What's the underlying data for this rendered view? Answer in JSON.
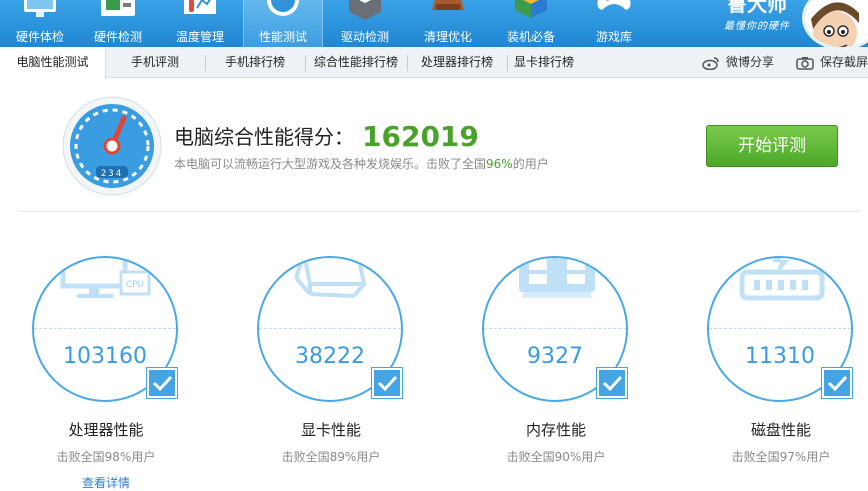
{
  "toolbar": {
    "items": [
      {
        "label": "硬件体检",
        "icon": "monitor-icon"
      },
      {
        "label": "硬件检测",
        "icon": "chip-icon"
      },
      {
        "label": "温度管理",
        "icon": "thermometer-icon"
      },
      {
        "label": "性能测试",
        "icon": "speedometer-icon",
        "active": true
      },
      {
        "label": "驱动检测",
        "icon": "driver-box-icon"
      },
      {
        "label": "清理优化",
        "icon": "broom-icon"
      },
      {
        "label": "装机必备",
        "icon": "windows-icon"
      },
      {
        "label": "游戏库",
        "icon": "gamepad-icon"
      }
    ],
    "brand_name": "鲁大师",
    "brand_slogan": "最懂你的硬件"
  },
  "subnav": {
    "tabs": [
      "电脑性能测试",
      "手机评测",
      "手机排行榜",
      "综合性能排行榜",
      "处理器排行榜",
      "显卡排行榜"
    ],
    "active_index": 0,
    "weibo_share": "微博分享",
    "save_screenshot": "保存截屏"
  },
  "score": {
    "title": "电脑综合性能得分：",
    "value": "162019",
    "desc_prefix": "本电脑可以流畅运行大型游戏及各种发烧娱乐。击败了全国",
    "desc_pct": "96%",
    "desc_suffix": "的用户",
    "gauge_readout": "234",
    "start_button": "开始评测"
  },
  "cards": [
    {
      "value": "103160",
      "title": "处理器性能",
      "sub": "击败全国98%用户",
      "art_label": "CPU"
    },
    {
      "value": "38222",
      "title": "显卡性能",
      "sub": "击败全国89%用户"
    },
    {
      "value": "9327",
      "title": "内存性能",
      "sub": "击败全国90%用户"
    },
    {
      "value": "11310",
      "title": "磁盘性能",
      "sub": "击败全国97%用户"
    }
  ],
  "details_link": "查看详情",
  "colors": {
    "accent": "#3b9be0",
    "green": "#49a32a",
    "toolbar": "#2a92dc"
  }
}
